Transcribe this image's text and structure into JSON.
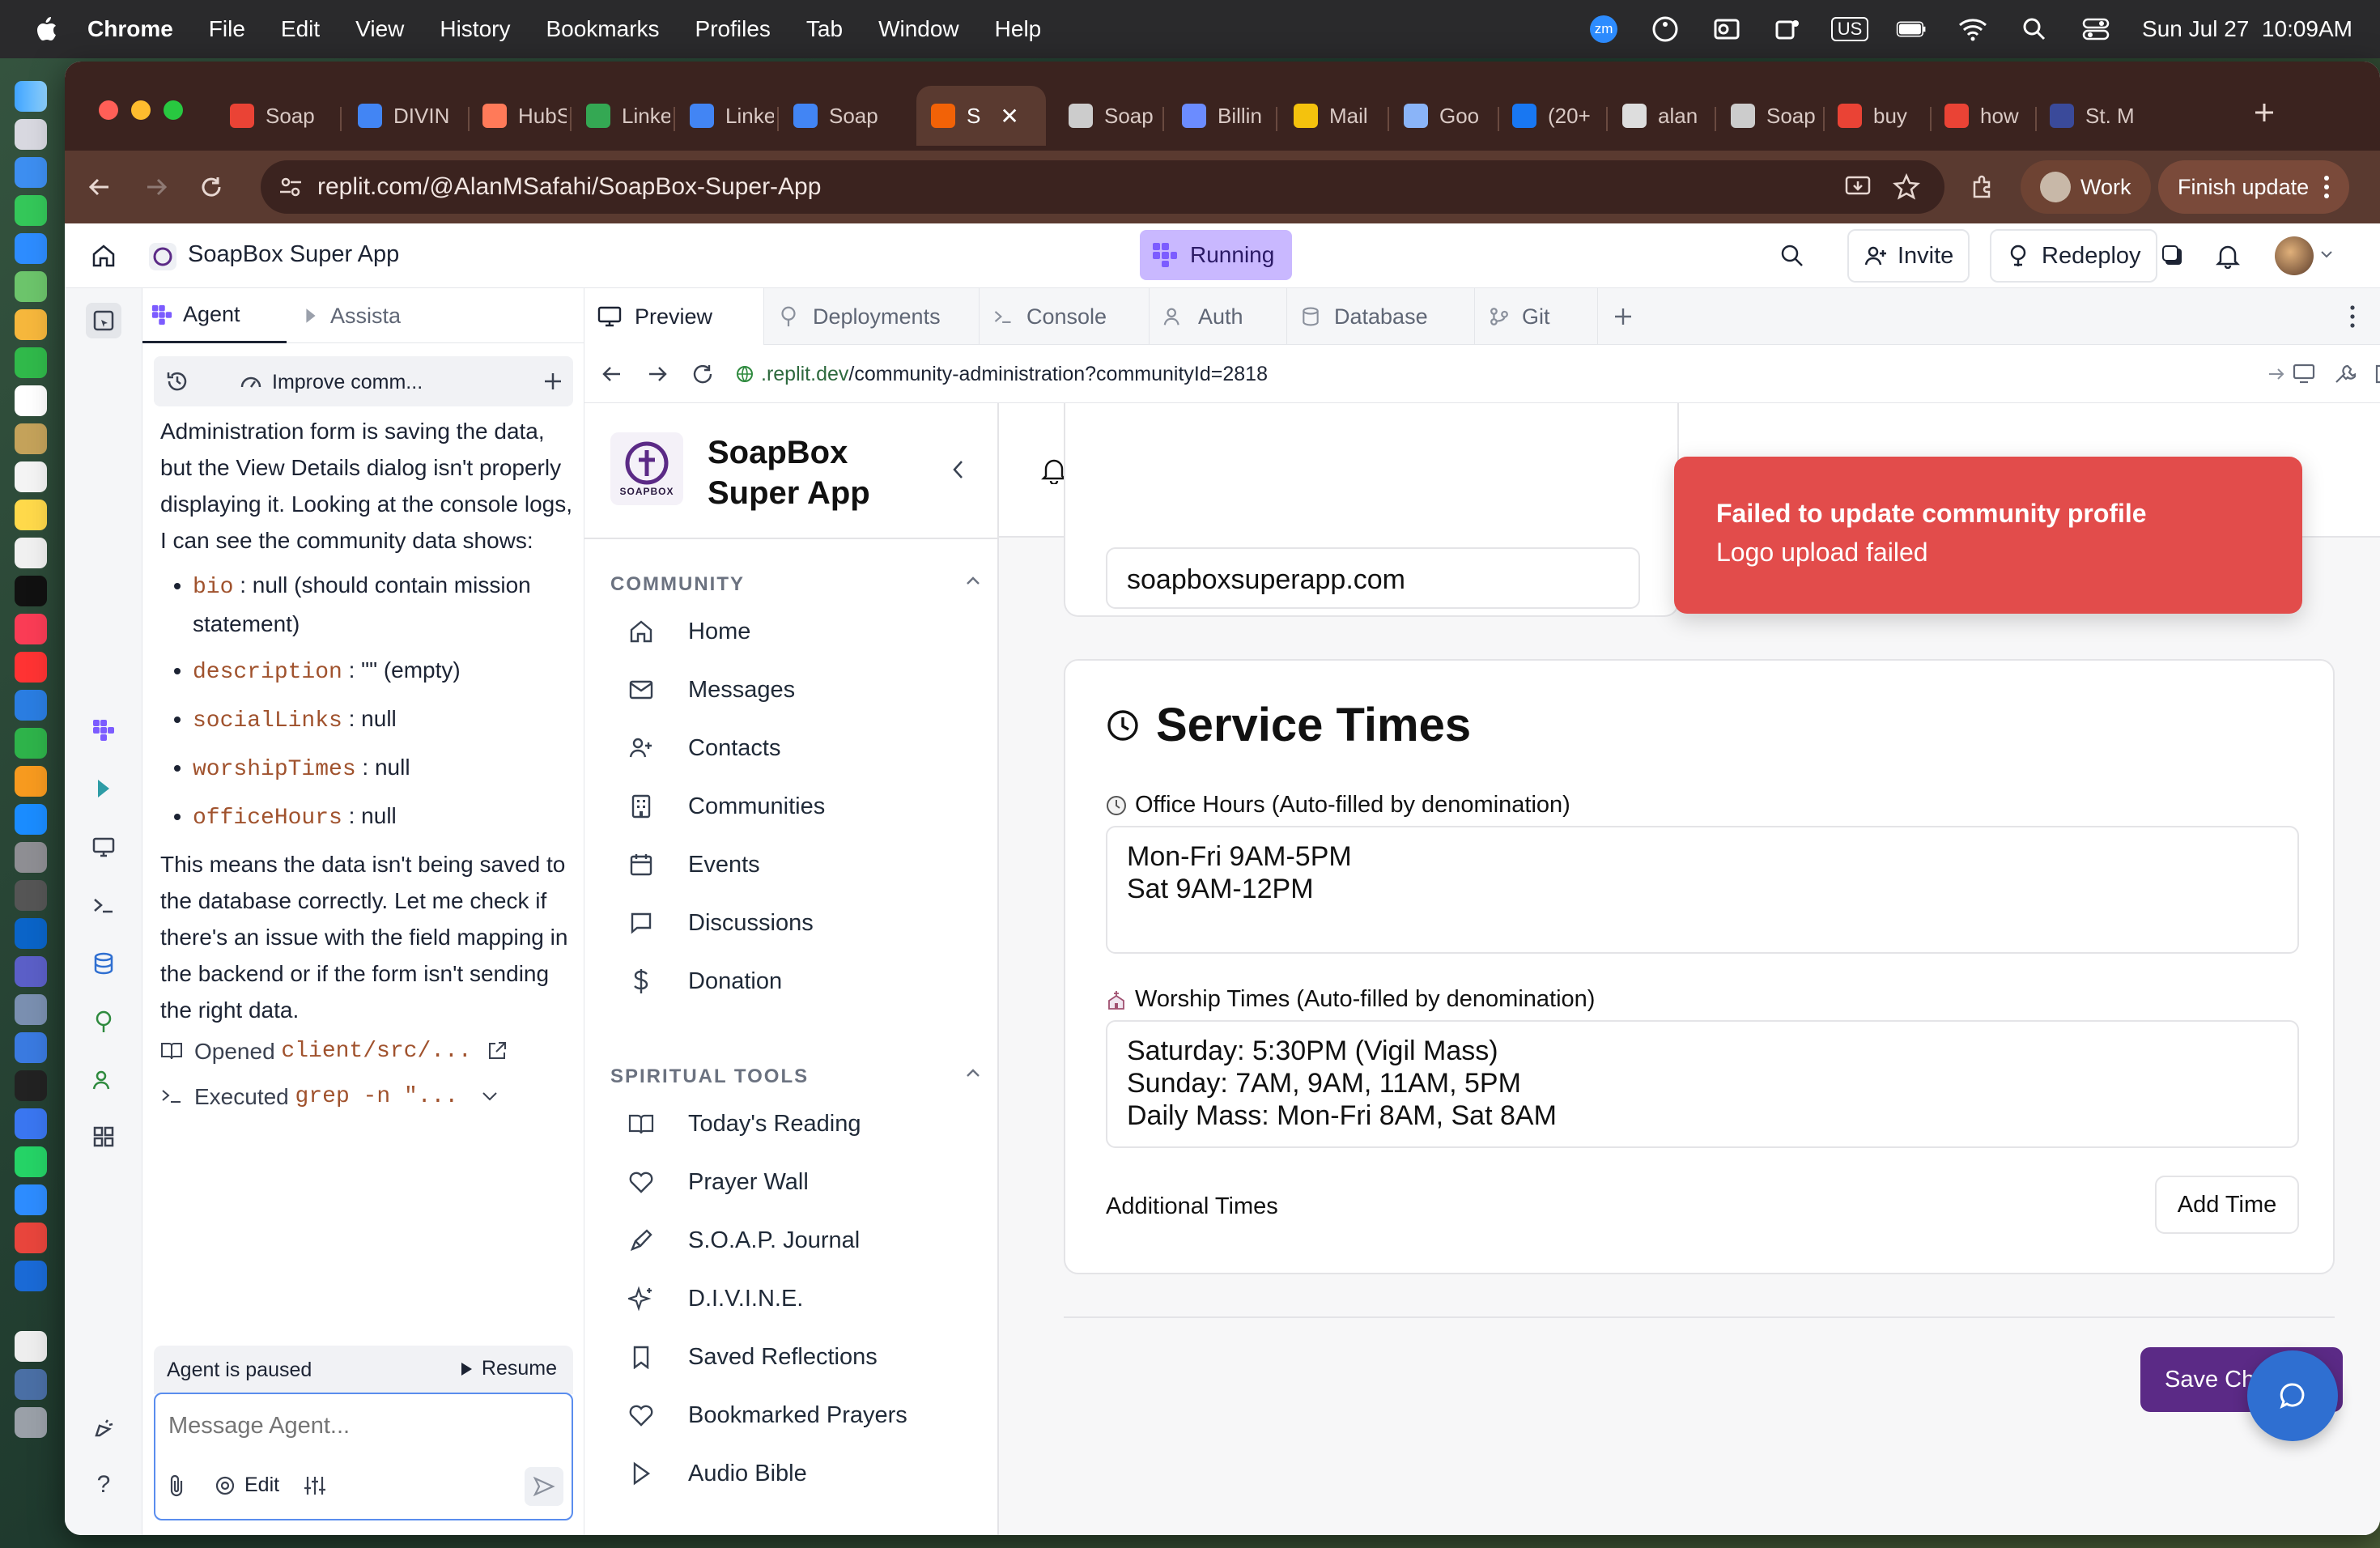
{
  "menubar": {
    "app": "Chrome",
    "items": [
      "File",
      "Edit",
      "View",
      "History",
      "Bookmarks",
      "Profiles",
      "Tab",
      "Window",
      "Help"
    ],
    "badge": "zm",
    "input_source": "US",
    "datetime": "Sun Jul 27  10:09AM"
  },
  "browser": {
    "tabs": [
      {
        "label": "Soap",
        "color": "#ea4335"
      },
      {
        "label": "DIVIN",
        "color": "#4285f4"
      },
      {
        "label": "HubS",
        "color": "#ff7a59"
      },
      {
        "label": "Linke",
        "color": "#34a853"
      },
      {
        "label": "Linke",
        "color": "#4285f4"
      },
      {
        "label": "Soap",
        "color": "#4285f4"
      },
      {
        "label": "S",
        "color": "#f26207"
      },
      {
        "label": "Soap",
        "color": "#cccccc"
      },
      {
        "label": "Billin",
        "color": "#6b8cff"
      },
      {
        "label": "Mail",
        "color": "#f4c20d"
      },
      {
        "label": "Goo",
        "color": "#8ab4f8"
      },
      {
        "label": "(20+",
        "color": "#1877f2"
      },
      {
        "label": "alan",
        "color": "#dddddd"
      },
      {
        "label": "Soap",
        "color": "#cccccc"
      },
      {
        "label": "buy",
        "color": "#ea4335"
      },
      {
        "label": "how",
        "color": "#ea4335"
      },
      {
        "label": "St. M",
        "color": "#3a4a9a"
      }
    ],
    "url": "replit.com/@AlanMSafahi/SoapBox-Super-App",
    "profile_label": "Work",
    "finish_update": "Finish update"
  },
  "replit": {
    "project_name": "SoapBox Super App",
    "status": "Running",
    "invite": "Invite",
    "redeploy": "Redeploy",
    "agent_tab": "Agent",
    "assistant_tab": "Assista",
    "history_title": "Improve comm...",
    "agent_paragraph1": "Administration form is saving the data, but the View Details dialog isn't properly displaying it. Looking at the console logs, I can see the community data shows:",
    "fields": [
      {
        "code": "bio",
        "text": " : null (should contain mission statement)"
      },
      {
        "code": "description",
        "text": " : \"\" (empty)"
      },
      {
        "code": "socialLinks",
        "text": " : null"
      },
      {
        "code": "worshipTimes",
        "text": " : null"
      },
      {
        "code": "officeHours",
        "text": " : null"
      }
    ],
    "agent_paragraph2": "This means the data isn't being saved to the database correctly. Let me check if there's an issue with the field mapping in the backend or if the form isn't sending the right data.",
    "action_opened_label": "Opened ",
    "action_opened_code": "client/src/...",
    "action_exec_label": "Executed ",
    "action_exec_code": "grep -n \"...",
    "paused": "Agent is paused",
    "resume": "Resume",
    "input_placeholder": "Message Agent...",
    "edit": "Edit",
    "ws_tabs": [
      "Preview",
      "Deployments",
      "Console",
      "Auth",
      "Database",
      "Git"
    ],
    "preview_url_host": ".replit.dev",
    "preview_url_path": "/community-administration?communityId=2818"
  },
  "app": {
    "brand_line1": "SoapBox",
    "brand_line2": "Super App",
    "logo_text": "SOAPBOX",
    "community_heading": "COMMUNITY",
    "community_nav": [
      "Home",
      "Messages",
      "Contacts",
      "Communities",
      "Events",
      "Discussions",
      "Donation"
    ],
    "spiritual_heading": "SPIRITUAL TOOLS",
    "spiritual_nav": [
      "Today's Reading",
      "Prayer Wall",
      "S.O.A.P. Journal",
      "D.I.V.I.N.E.",
      "Saved Reflections",
      "Bookmarked Prayers",
      "Audio Bible"
    ],
    "website_value": "soapboxsuperapp.com",
    "service_times_title": "Service Times",
    "office_hours_label": "Office Hours (Auto-filled by denomination)",
    "office_hours_value": "Mon-Fri 9AM-5PM\nSat 9AM-12PM",
    "worship_label": "Worship Times (Auto-filled by denomination)",
    "worship_value": "Saturday: 5:30PM (Vigil Mass)\nSunday: 7AM, 9AM, 11AM, 5PM\nDaily Mass: Mon-Fri 8AM, Sat 8AM",
    "additional_times": "Additional Times",
    "add_time": "Add Time",
    "save_changes": "Save Changes",
    "toast_title": "Failed to update community profile",
    "toast_msg": "Logo upload failed",
    "colors": {
      "toast": "#e24c4b",
      "save": "#5b2a86",
      "fab": "#2f6fd1",
      "running": "#c9b8ff"
    }
  }
}
